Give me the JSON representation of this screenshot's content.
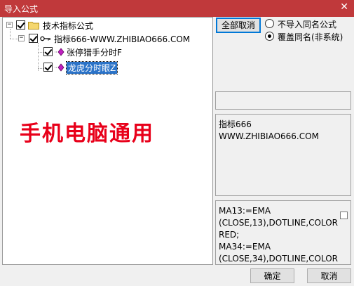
{
  "window": {
    "title": "导入公式",
    "close_glyph": "✕"
  },
  "tree": {
    "root": {
      "label": "技术指标公式",
      "expander": "−"
    },
    "group": {
      "label": "指标666-WWW.ZHIBIAO666.COM",
      "expander": "−"
    },
    "items": [
      {
        "label": "张停猎手分时F"
      },
      {
        "label": "龙虎分时眼Z"
      }
    ]
  },
  "watermark": "手机电脑通用",
  "buttons": {
    "deselect_all": "全部取消",
    "ok": "确定",
    "cancel": "取消"
  },
  "options": {
    "skip_same_name": "不导入同名公式",
    "overwrite_same_name": "覆盖同名(非系统)",
    "selected": "overwrite_same_name"
  },
  "info": {
    "line1": "指标666",
    "line2": "WWW.ZHIBIAO666.COM"
  },
  "code": {
    "lines": [
      "MA13:=EMA",
      "(CLOSE,13),DOTLINE,COLOR",
      "RED;",
      "MA34:=EMA",
      "(CLOSE,34),DOTLINE,COLOR"
    ]
  }
}
